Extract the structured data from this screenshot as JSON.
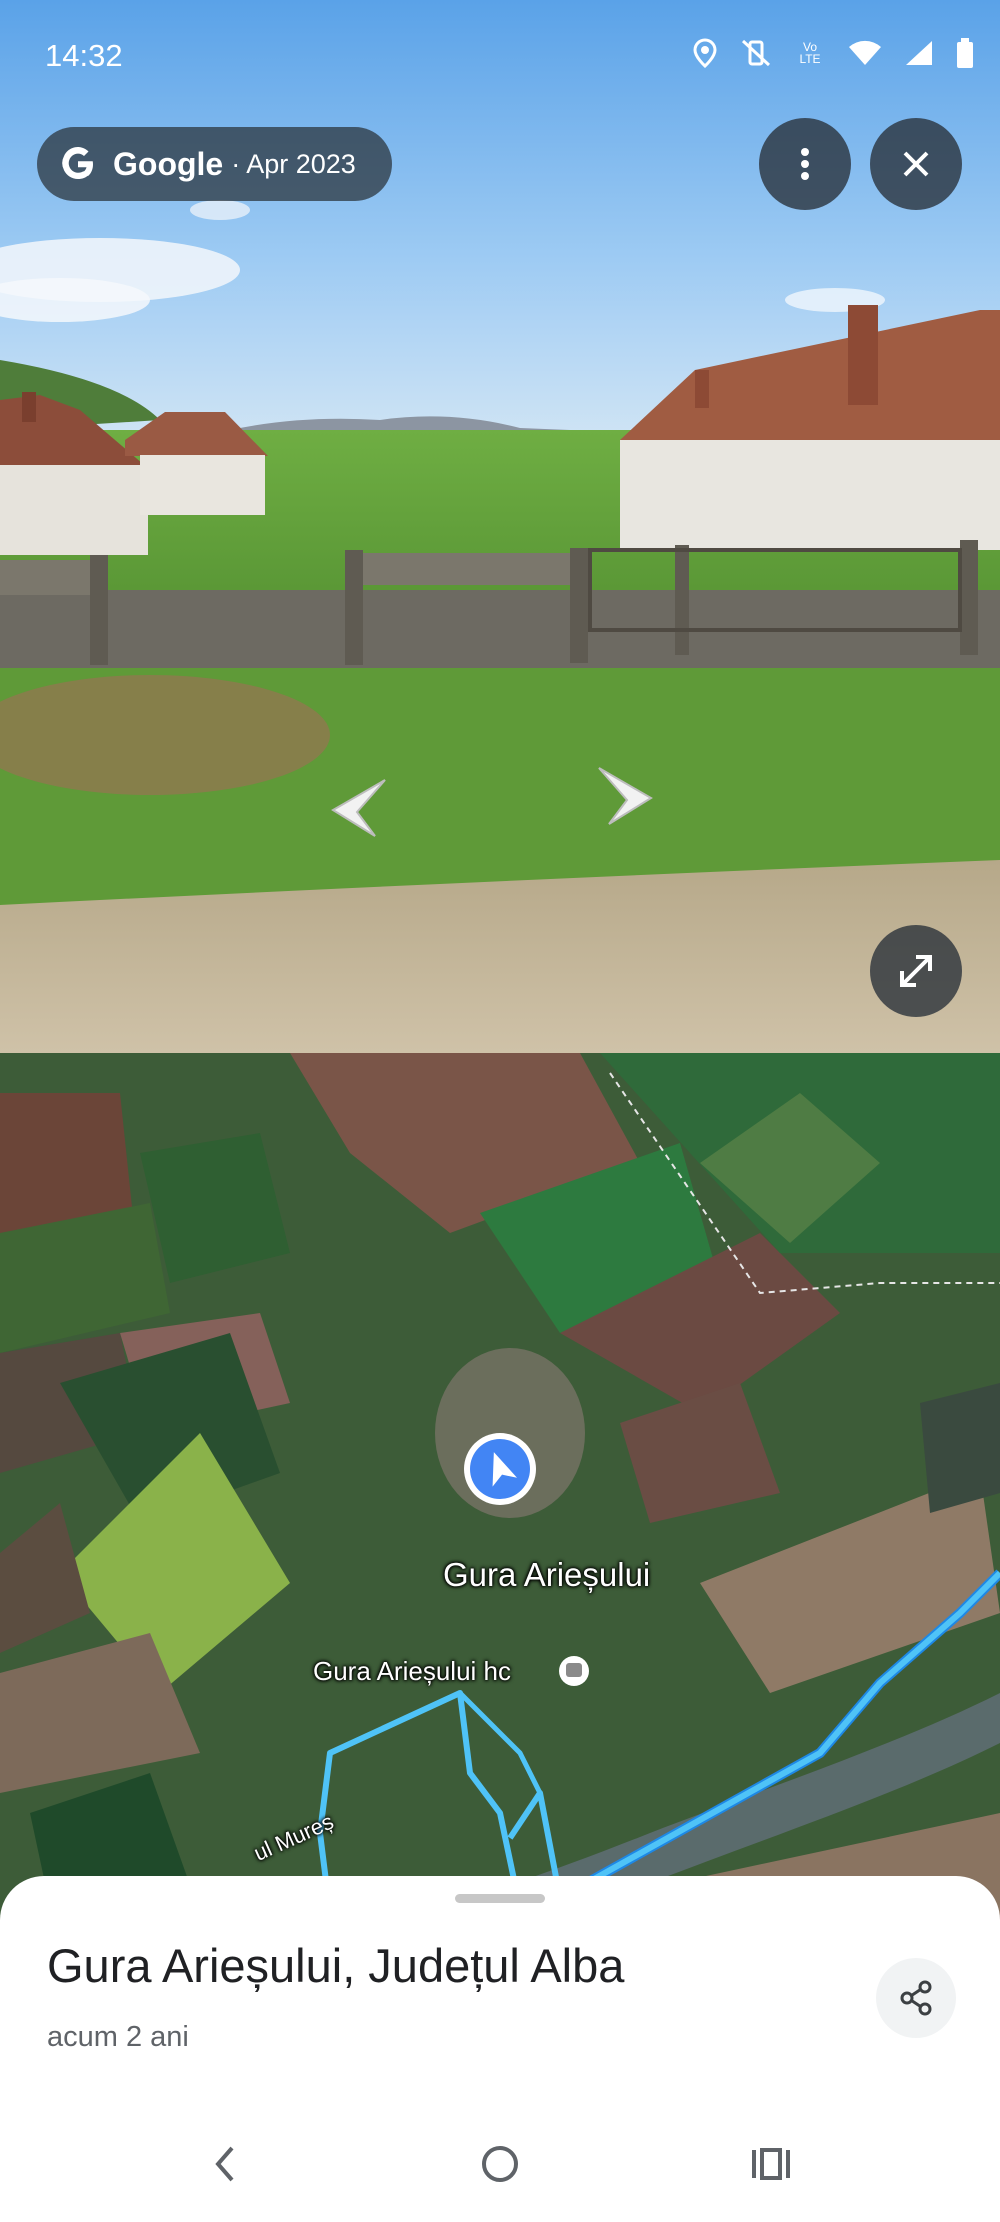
{
  "status_bar": {
    "time": "14:32",
    "icons": [
      "location-icon",
      "mute-vibrate-icon",
      "volte-icon",
      "wifi-icon",
      "signal-icon",
      "battery-icon"
    ],
    "volte_text": "Vo LTE"
  },
  "street_view": {
    "source_label": "Google",
    "date_label": "· Apr 2023",
    "buttons": [
      "more-options-icon",
      "close-icon",
      "expand-icon"
    ],
    "nav_arrows": [
      "left",
      "right"
    ]
  },
  "map": {
    "place_label": "Gura Arieșului",
    "station_label": "Gura Arieșului hc",
    "river_label": "ul Mureș",
    "route_color": "#4fc3f7",
    "marker_color": "#4285f4"
  },
  "sheet": {
    "title": "Gura Arieșului, Județul Alba",
    "subtitle": "acum 2 ani"
  },
  "navigation_bar": [
    "back-icon",
    "home-icon",
    "recents-icon"
  ]
}
